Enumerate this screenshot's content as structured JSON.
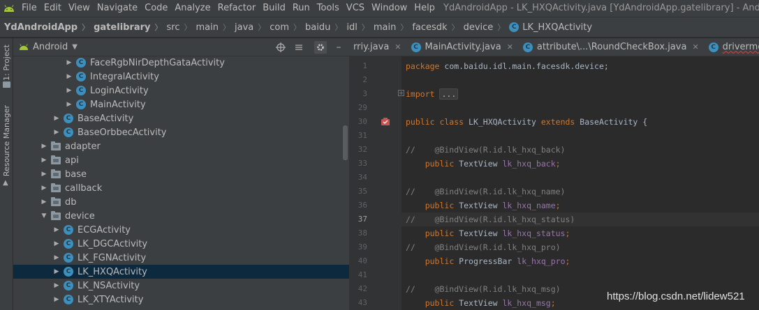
{
  "menubar": {
    "items": [
      "File",
      "Edit",
      "View",
      "Navigate",
      "Code",
      "Analyze",
      "Refactor",
      "Build",
      "Run",
      "Tools",
      "VCS",
      "Window",
      "Help"
    ],
    "window_title": "YdAndroidApp - LK_HXQActivity.java [YdAndroidApp.gatelibrary] - Android St"
  },
  "breadcrumb": {
    "items": [
      "YdAndroidApp",
      "gatelibrary",
      "src",
      "main",
      "java",
      "com",
      "baidu",
      "idl",
      "main",
      "facesdk",
      "device",
      "LK_HXQActivity"
    ]
  },
  "sidebar": {
    "tab_project": "1: Project",
    "tab_resource": "Resource Manager"
  },
  "project_pane": {
    "view_mode": "Android",
    "tree": [
      {
        "label": "FaceRgbNirDepthGataActivity",
        "kind": "class",
        "depth": 3,
        "expanded": false
      },
      {
        "label": "IntegralActivity",
        "kind": "class",
        "depth": 3,
        "expanded": false
      },
      {
        "label": "LoginActivity",
        "kind": "class",
        "depth": 3,
        "expanded": false
      },
      {
        "label": "MainActivity",
        "kind": "class",
        "depth": 3,
        "expanded": false
      },
      {
        "label": "BaseActivity",
        "kind": "class",
        "depth": 2,
        "expanded": false
      },
      {
        "label": "BaseOrbbecActivity",
        "kind": "class",
        "depth": 2,
        "expanded": false
      },
      {
        "label": "adapter",
        "kind": "folder",
        "depth": 1,
        "expanded": false
      },
      {
        "label": "api",
        "kind": "folder",
        "depth": 1,
        "expanded": false
      },
      {
        "label": "base",
        "kind": "folder",
        "depth": 1,
        "expanded": false
      },
      {
        "label": "callback",
        "kind": "folder",
        "depth": 1,
        "expanded": false
      },
      {
        "label": "db",
        "kind": "folder",
        "depth": 1,
        "expanded": false
      },
      {
        "label": "device",
        "kind": "folder",
        "depth": 1,
        "expanded": true
      },
      {
        "label": "ECGActivity",
        "kind": "class",
        "depth": 2,
        "expanded": false
      },
      {
        "label": "LK_DGCActivity",
        "kind": "class",
        "depth": 2,
        "expanded": false
      },
      {
        "label": "LK_FGNActivity",
        "kind": "class",
        "depth": 2,
        "expanded": false
      },
      {
        "label": "LK_HXQActivity",
        "kind": "class",
        "depth": 2,
        "expanded": false,
        "selected": true
      },
      {
        "label": "LK_NSActivity",
        "kind": "class",
        "depth": 2,
        "expanded": false
      },
      {
        "label": "LK_XTYActivity",
        "kind": "class",
        "depth": 2,
        "expanded": false
      }
    ]
  },
  "editor": {
    "tabs": [
      {
        "label": "rriy.java",
        "icon": false,
        "error": false
      },
      {
        "label": "MainActivity.java",
        "icon": true,
        "error": false
      },
      {
        "label": "attribute\\...\\RoundCheckBox.java",
        "icon": true,
        "error": false
      },
      {
        "label": "drivermonitor\\...\\R",
        "icon": true,
        "error": true
      }
    ],
    "current_line": "37",
    "lines": [
      {
        "num": "1",
        "tokens": [
          [
            "k",
            "package "
          ],
          [
            "t",
            "com.baidu.idl.main.facesdk.device;"
          ]
        ]
      },
      {
        "num": "2",
        "tokens": []
      },
      {
        "num": "3",
        "tokens": [
          [
            "k",
            "import "
          ],
          [
            "box",
            "..."
          ]
        ],
        "fold": true
      },
      {
        "num": "29",
        "tokens": []
      },
      {
        "num": "30",
        "tokens": [
          [
            "k",
            "public class "
          ],
          [
            "t",
            "LK_HXQActivity "
          ],
          [
            "k",
            "extends "
          ],
          [
            "t",
            "BaseActivity {"
          ]
        ],
        "run": true
      },
      {
        "num": "31",
        "tokens": []
      },
      {
        "num": "32",
        "tokens": [
          [
            "c",
            "//    @BindView(R.id.lk_hxq_back)"
          ]
        ]
      },
      {
        "num": "33",
        "tokens": [
          [
            "t",
            "    "
          ],
          [
            "k",
            "public "
          ],
          [
            "t",
            "TextView "
          ],
          [
            "f",
            "lk_hxq_back"
          ],
          [
            "k",
            ";"
          ]
        ]
      },
      {
        "num": "34",
        "tokens": []
      },
      {
        "num": "35",
        "tokens": [
          [
            "c",
            "//    @BindView(R.id.lk_hxq_name)"
          ]
        ]
      },
      {
        "num": "36",
        "tokens": [
          [
            "t",
            "    "
          ],
          [
            "k",
            "public "
          ],
          [
            "t",
            "TextView "
          ],
          [
            "f",
            "lk_hxq_name"
          ],
          [
            "k",
            ";"
          ]
        ]
      },
      {
        "num": "37",
        "tokens": [
          [
            "c",
            "//    @BindView(R.id.lk_hxq_status)"
          ]
        ]
      },
      {
        "num": "38",
        "tokens": [
          [
            "t",
            "    "
          ],
          [
            "k",
            "public "
          ],
          [
            "t",
            "TextView "
          ],
          [
            "f",
            "lk_hxq_status"
          ],
          [
            "k",
            ";"
          ]
        ]
      },
      {
        "num": "39",
        "tokens": [
          [
            "c",
            "//    @BindView(R.id.lk_hxq_pro)"
          ]
        ]
      },
      {
        "num": "40",
        "tokens": [
          [
            "t",
            "    "
          ],
          [
            "k",
            "public "
          ],
          [
            "t",
            "ProgressBar "
          ],
          [
            "f",
            "lk_hxq_pro"
          ],
          [
            "k",
            ";"
          ]
        ]
      },
      {
        "num": "41",
        "tokens": []
      },
      {
        "num": "42",
        "tokens": [
          [
            "c",
            "//    @BindView(R.id.lk_hxq_msg)"
          ]
        ]
      },
      {
        "num": "43",
        "tokens": [
          [
            "t",
            "    "
          ],
          [
            "k",
            "public "
          ],
          [
            "t",
            "TextView "
          ],
          [
            "f",
            "lk_hxq_msg"
          ],
          [
            "k",
            ";"
          ]
        ]
      }
    ]
  },
  "watermark": "https://blog.csdn.net/lidew521",
  "colors": {
    "keyword": "#cc7832",
    "field": "#9876aa",
    "comment": "#808080",
    "text": "#a9b7c6",
    "selection": "#0d293e",
    "class_icon": "#3d8fbe"
  }
}
